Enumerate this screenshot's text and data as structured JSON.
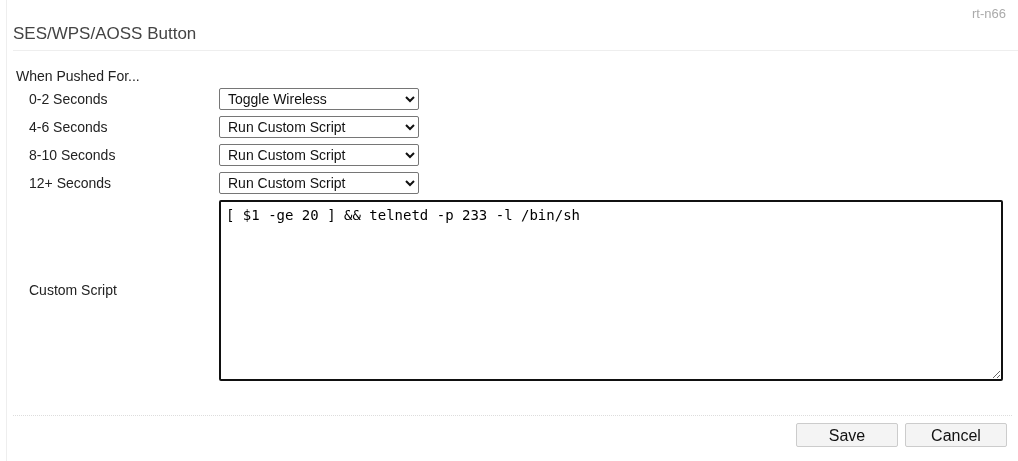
{
  "model": "rt-n66",
  "title": "SES/WPS/AOSS Button",
  "section_label": "When Pushed For...",
  "actions": [
    {
      "label": "0-2 Seconds",
      "value": "Toggle Wireless"
    },
    {
      "label": "4-6 Seconds",
      "value": "Run Custom Script"
    },
    {
      "label": "8-10 Seconds",
      "value": "Run Custom Script"
    },
    {
      "label": "12+ Seconds",
      "value": "Run Custom Script"
    }
  ],
  "custom_script": {
    "label": "Custom Script",
    "value": "[ $1 -ge 20 ] && telnetd -p 233 -l /bin/sh",
    "focused": true
  },
  "buttons": [
    "Save",
    "Cancel"
  ]
}
